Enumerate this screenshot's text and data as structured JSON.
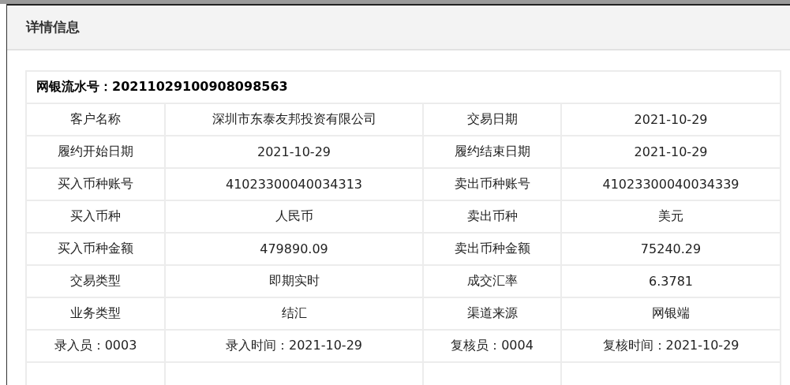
{
  "dialog": {
    "title": "详情信息"
  },
  "serial": "网银流水号：20211029100908098563",
  "rows": [
    [
      "客户名称",
      "深圳市东泰友邦投资有限公司",
      "交易日期",
      "2021-10-29"
    ],
    [
      "履约开始日期",
      "2021-10-29",
      "履约结束日期",
      "2021-10-29"
    ],
    [
      "买入币种账号",
      "41023300040034313",
      "卖出币种账号",
      "41023300040034339"
    ],
    [
      "买入币种",
      "人民币",
      "卖出币种",
      "美元"
    ],
    [
      "买入币种金额",
      "479890.09",
      "卖出币种金额",
      "75240.29"
    ],
    [
      "交易类型",
      "即期实时",
      "成交汇率",
      "6.3781"
    ],
    [
      "业务类型",
      "结汇",
      "渠道来源",
      "网银端"
    ],
    [
      "录入员：0003",
      "录入时间：2021-10-29",
      "复核员：0004",
      "复核时间：2021-10-29"
    ]
  ]
}
